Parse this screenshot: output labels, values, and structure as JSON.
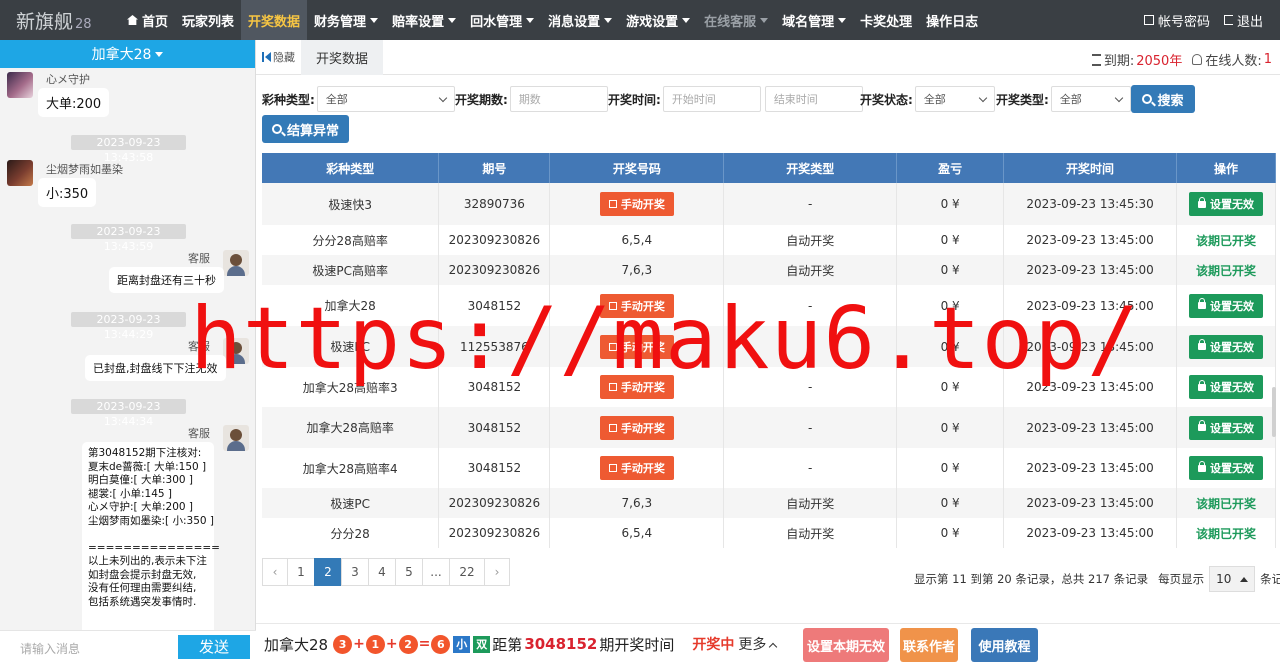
{
  "brand": {
    "name": "新旗舰",
    "version": "28"
  },
  "nav": {
    "items": [
      {
        "label": "首页"
      },
      {
        "label": "玩家列表"
      },
      {
        "label": "开奖数据"
      },
      {
        "label": "财务管理"
      },
      {
        "label": "赔率设置"
      },
      {
        "label": "回水管理"
      },
      {
        "label": "消息设置"
      },
      {
        "label": "游戏设置"
      },
      {
        "label": "在线客服"
      },
      {
        "label": "域名管理"
      },
      {
        "label": "卡奖处理"
      },
      {
        "label": "操作日志"
      }
    ],
    "account": "帐号密码",
    "logout": "退出"
  },
  "chat": {
    "room": "加拿大28",
    "messages": [
      {
        "nick": "心メ守护",
        "text": "大单:200"
      },
      {
        "time": "2023-09-23 13:43:58"
      },
      {
        "nick": "尘烟梦雨如墨染",
        "text": "小:350"
      },
      {
        "time": "2023-09-23 13:43:59"
      },
      {
        "nick": "客服",
        "text": "距离封盘还有三十秒"
      },
      {
        "time": "2023-09-23 13:44:29"
      },
      {
        "nick": "客服",
        "text": "已封盘,封盘线下下注无效"
      },
      {
        "time": "2023-09-23 13:44:34"
      },
      {
        "nick": "客服",
        "lines": [
          "第3048152期下注核对:",
          "夏末de蔷薇:[ 大单:150 ]",
          "明白莫僮:[ 大单:300 ]",
          "褪裳:[ 小单:145 ]",
          "心メ守护:[ 大单:200 ]",
          "尘烟梦雨如墨染:[ 小:350 ]",
          "",
          "===============",
          "以上未列出的,表示未下注",
          "如封盘会提示封盘无效,",
          "没有任何理由需要纠结,",
          "包括系统遇突发事情时."
        ]
      }
    ],
    "input_placeholder": "请输入消息",
    "send": "发送"
  },
  "tabbar": {
    "hide": "隐藏",
    "tab": "开奖数据",
    "expire_label": "到期:",
    "expire_value": "2050年",
    "online_label": "在线人数:",
    "online_value": "1"
  },
  "filters": {
    "lottery_type_label": "彩种类型:",
    "lottery_type_value": "全部",
    "period_label": "开奖期数:",
    "period_placeholder": "期数",
    "time_label": "开奖时间:",
    "start_placeholder": "开始时间",
    "end_placeholder": "结束时间",
    "status_label": "开奖状态:",
    "status_value": "全部",
    "draw_type_label": "开奖类型:",
    "draw_type_value": "全部",
    "search": "搜索",
    "settle_error": "结算异常"
  },
  "table": {
    "headers": [
      "彩种类型",
      "期号",
      "开奖号码",
      "开奖类型",
      "盈亏",
      "开奖时间",
      "操作"
    ],
    "manual_label": "手动开奖",
    "invalid_label": "设置无效",
    "opened_label": "该期已开奖",
    "rows": [
      {
        "type": "极速快3",
        "period": "32890736",
        "number": "",
        "draw_type": "-",
        "profit": "0 ¥",
        "time": "2023-09-23 13:45:30",
        "manual": true
      },
      {
        "type": "分分28高赔率",
        "period": "202309230826",
        "number": "6,5,4",
        "draw_type": "自动开奖",
        "profit": "0 ¥",
        "time": "2023-09-23 13:45:00",
        "manual": false
      },
      {
        "type": "极速PC高赔率",
        "period": "202309230826",
        "number": "7,6,3",
        "draw_type": "自动开奖",
        "profit": "0 ¥",
        "time": "2023-09-23 13:45:00",
        "manual": false
      },
      {
        "type": "加拿大28",
        "period": "3048152",
        "number": "",
        "draw_type": "-",
        "profit": "0 ¥",
        "time": "2023-09-23 13:45:00",
        "manual": true
      },
      {
        "type": "极速PC",
        "period": "112553876",
        "number": "",
        "draw_type": "-",
        "profit": "0 ¥",
        "time": "2023-09-23 13:45:00",
        "manual": true
      },
      {
        "type": "加拿大28高赔率3",
        "period": "3048152",
        "number": "",
        "draw_type": "-",
        "profit": "0 ¥",
        "time": "2023-09-23 13:45:00",
        "manual": true
      },
      {
        "type": "加拿大28高赔率",
        "period": "3048152",
        "number": "",
        "draw_type": "-",
        "profit": "0 ¥",
        "time": "2023-09-23 13:45:00",
        "manual": true
      },
      {
        "type": "加拿大28高赔率4",
        "period": "3048152",
        "number": "",
        "draw_type": "-",
        "profit": "0 ¥",
        "time": "2023-09-23 13:45:00",
        "manual": true
      },
      {
        "type": "极速PC",
        "period": "202309230826",
        "number": "7,6,3",
        "draw_type": "自动开奖",
        "profit": "0 ¥",
        "time": "2023-09-23 13:45:00",
        "manual": false
      },
      {
        "type": "分分28",
        "period": "202309230826",
        "number": "6,5,4",
        "draw_type": "自动开奖",
        "profit": "0 ¥",
        "time": "2023-09-23 13:45:00",
        "manual": false
      }
    ]
  },
  "pagination": {
    "prev": "‹",
    "pages": [
      "1",
      "2",
      "3",
      "4",
      "5",
      "...",
      "22"
    ],
    "active": "2",
    "next": "›",
    "info": "显示第 11 到第 20 条记录，总共 217 条记录",
    "per_page_label": "每页显示",
    "per_page_value": "10",
    "per_page_suffix": "条记录"
  },
  "bottom": {
    "game": "加拿大28",
    "balls": [
      "3",
      "1",
      "2",
      "6"
    ],
    "ops": [
      "+",
      "+",
      "="
    ],
    "tag1": "小",
    "tag2": "双",
    "prefix": "距第",
    "period": "3048152",
    "suffix": "期开奖时间",
    "status": "开奖中",
    "more": "更多",
    "btn_invalid": "设置本期无效",
    "btn_contact": "联系作者",
    "btn_tutorial": "使用教程"
  },
  "watermark": "https://maku6.top/",
  "colors": {
    "nav_bg": "#3a3f44",
    "active_nav": "#f6c543",
    "primary": "#337ab7",
    "chat_accent": "#1ea6e5",
    "danger": "#ee5a32",
    "success": "#1d9a5b"
  }
}
